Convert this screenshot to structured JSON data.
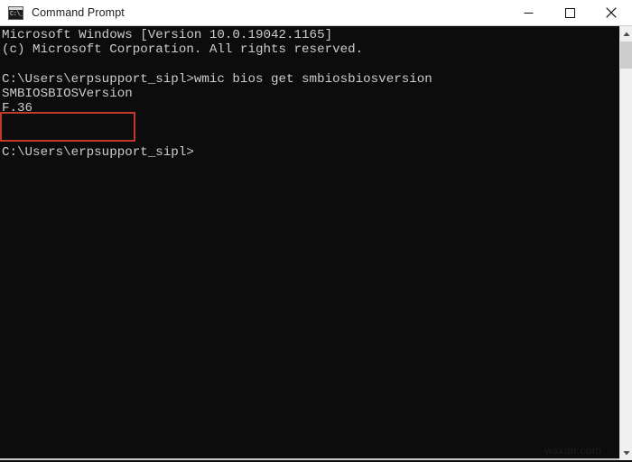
{
  "window": {
    "title": "Command Prompt",
    "icon": "command-prompt-icon",
    "icon_glyph": "C:\\_",
    "background_color": "#0c0c0c",
    "titlebar_color": "#ffffff",
    "controls": {
      "minimize": "Minimize",
      "maximize": "Maximize",
      "close": "Close"
    }
  },
  "console": {
    "foreground_color": "#cccccc",
    "lines": [
      "Microsoft Windows [Version 10.0.19042.1165]",
      "(c) Microsoft Corporation. All rights reserved.",
      "",
      "C:\\Users\\erpsupport_sipl>wmic bios get smbiosbiosversion",
      "SMBIOSBIOSVersion",
      "F.36",
      "",
      "",
      "C:\\Users\\erpsupport_sipl>"
    ],
    "text": "Microsoft Windows [Version 10.0.19042.1165]\n(c) Microsoft Corporation. All rights reserved.\n\nC:\\Users\\erpsupport_sipl>wmic bios get smbiosbiosversion\nSMBIOSBIOSVersion\nF.36\n\n\nC:\\Users\\erpsupport_sipl>",
    "command": "wmic bios get smbiosbiosversion",
    "output_header": "SMBIOSBIOSVersion",
    "output_value": "F.36",
    "prompt": "C:\\Users\\erpsupport_sipl>",
    "redacted_region": "username-partially-masked"
  },
  "annotation": {
    "highlight_color": "#c0392b",
    "highlight_target": "SMBIOSBIOSVersion / F.36"
  },
  "watermark": {
    "text": "wsxdn.com"
  },
  "scrollbar": {
    "up_arrow": "scroll-up",
    "down_arrow": "scroll-down",
    "thumb": "scroll-thumb"
  }
}
